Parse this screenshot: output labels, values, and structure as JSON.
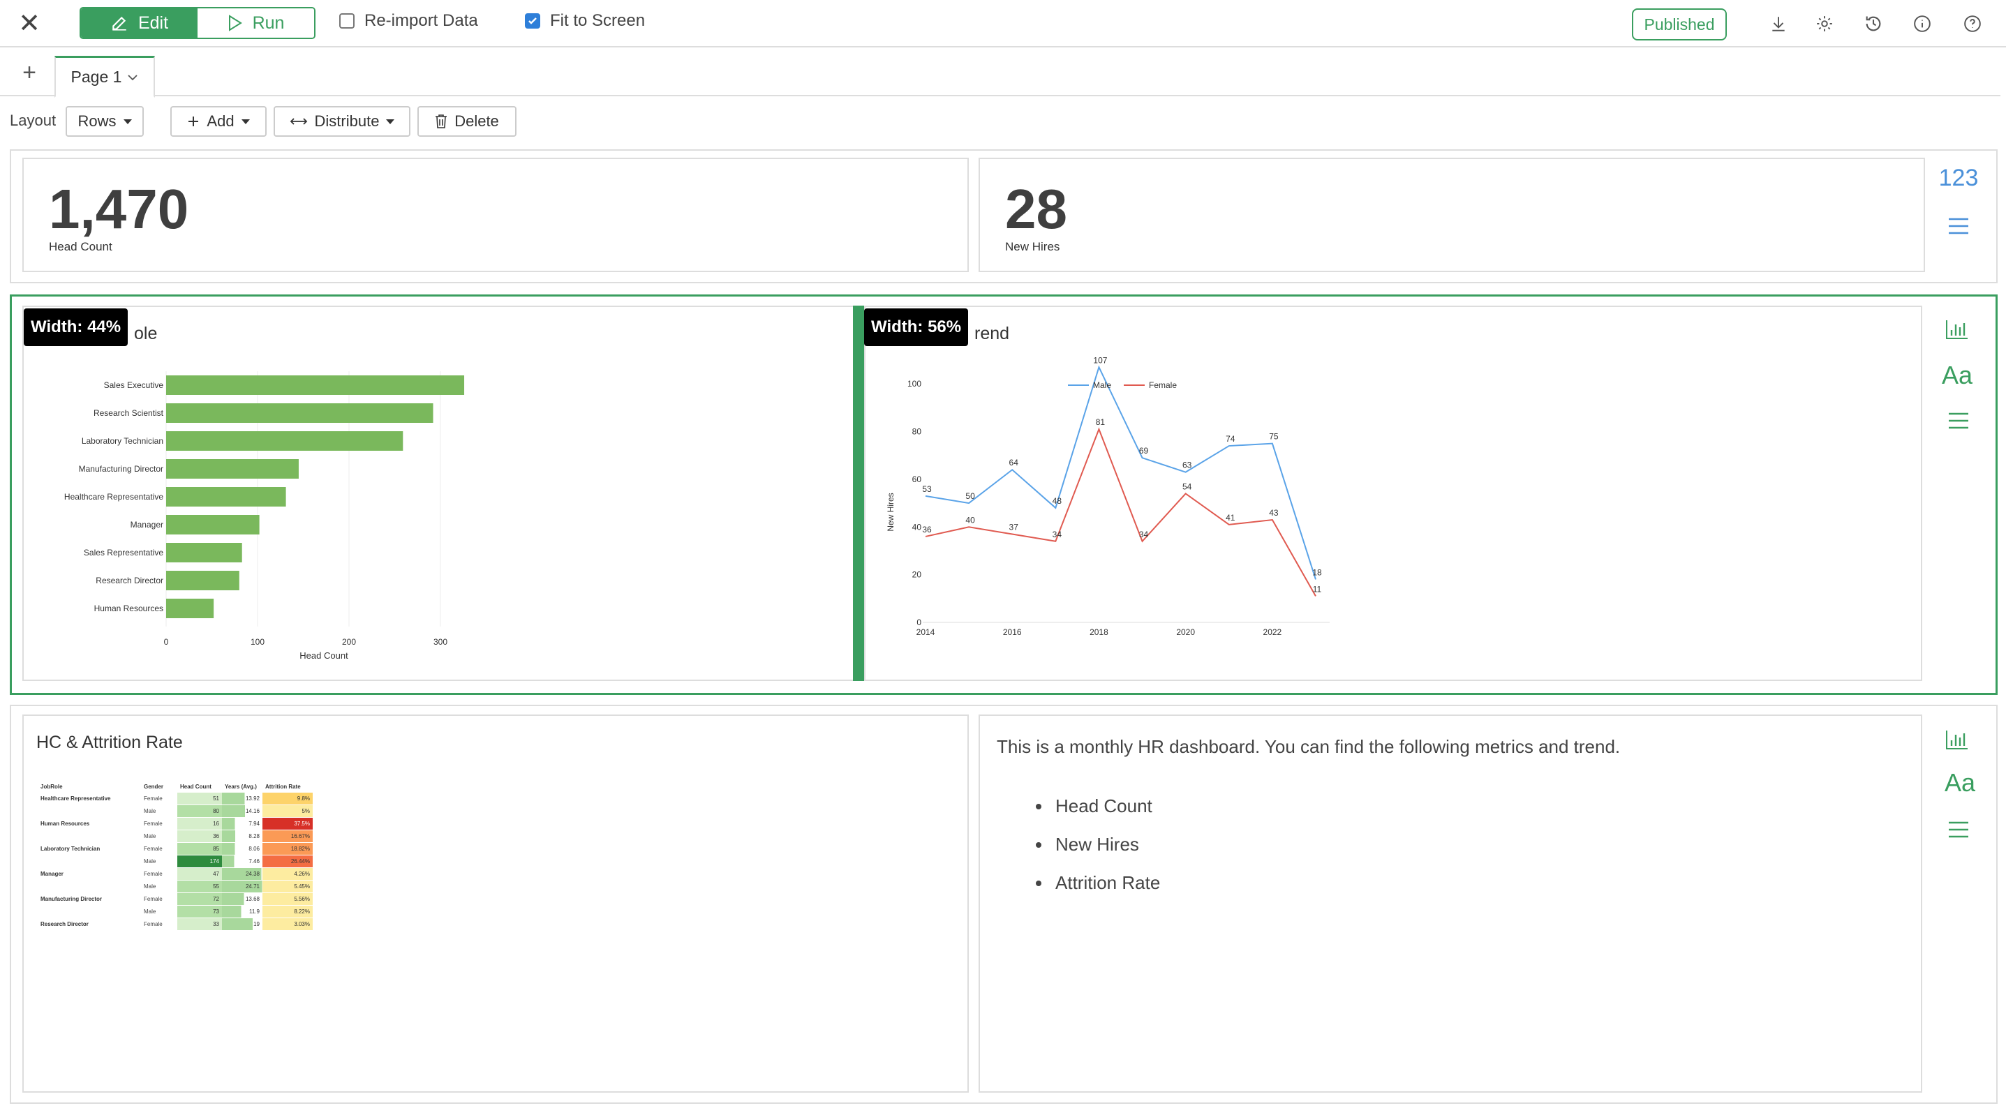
{
  "toolbar": {
    "close_glyph": "✕",
    "edit_label": "Edit",
    "run_label": "Run",
    "reimport_label": "Re-import Data",
    "reimport_checked": false,
    "fit_label": "Fit to Screen",
    "fit_checked": true,
    "published_label": "Published",
    "icons": [
      "download-icon",
      "gear-icon",
      "history-icon",
      "info-icon",
      "help-icon"
    ]
  },
  "pages": {
    "add_glyph": "+",
    "tabs": [
      {
        "label": "Page 1"
      }
    ]
  },
  "layout_bar": {
    "label": "Layout",
    "layout_value": "Rows",
    "add_label": "Add",
    "distribute_label": "Distribute",
    "delete_label": "Delete"
  },
  "kpis": [
    {
      "value": "1,470",
      "label": "Head Count"
    },
    {
      "value": "28",
      "label": "New Hires"
    }
  ],
  "row1_side": {
    "number_label": "123"
  },
  "colors": {
    "accent": "#3a9e5f",
    "bar": "#7ab85c",
    "male": "#5aa3e8",
    "female": "#e05a50"
  },
  "row2": {
    "left": {
      "width_tag": "Width: 44%",
      "title_visible": "ole"
    },
    "right": {
      "width_tag": "Width: 56%",
      "title_visible": "rend"
    }
  },
  "side_icons": {
    "font_label": "Aa"
  },
  "row3": {
    "table_title": "HC & Attrition Rate",
    "description": "This is a monthly HR dashboard. You can find the following metrics and trend.",
    "bullets": [
      "Head Count",
      "New Hires",
      "Attrition Rate"
    ]
  },
  "chart_data": [
    {
      "type": "bar",
      "orientation": "horizontal",
      "categories": [
        "Sales Executive",
        "Research Scientist",
        "Laboratory Technician",
        "Manufacturing Director",
        "Healthcare Representative",
        "Manager",
        "Sales Representative",
        "Research Director",
        "Human Resources"
      ],
      "values": [
        326,
        292,
        259,
        145,
        131,
        102,
        83,
        80,
        52
      ],
      "xlabel": "Head Count",
      "ylabel": "",
      "xlim": [
        0,
        330
      ],
      "xticks": [
        0,
        100,
        200,
        300
      ],
      "grid": true,
      "color": "#7ab85c"
    },
    {
      "type": "line",
      "x": [
        2014,
        2015,
        2016,
        2017,
        2018,
        2019,
        2020,
        2021,
        2022,
        2023
      ],
      "xticks": [
        "2014",
        "2016",
        "2018",
        "2020",
        "2022"
      ],
      "series": [
        {
          "name": "Male",
          "values": [
            53,
            50,
            64,
            48,
            107,
            69,
            63,
            74,
            75,
            18
          ],
          "color": "#5aa3e8"
        },
        {
          "name": "Female",
          "values": [
            36,
            40,
            37,
            34,
            81,
            34,
            54,
            41,
            43,
            11
          ],
          "color": "#e05a50"
        }
      ],
      "ylabel": "New Hires",
      "xlabel": "",
      "ylim": [
        0,
        110
      ],
      "yticks": [
        0,
        20,
        40,
        60,
        80,
        100
      ],
      "legend": "top-center",
      "grid": false
    },
    {
      "type": "table",
      "columns": [
        "JobRole",
        "Gender",
        "Head Count",
        "Years (Avg.)",
        "Attrition Rate"
      ],
      "rows": [
        [
          "Healthcare Representative",
          "Female",
          51,
          "13.92",
          "9.8%"
        ],
        [
          "",
          "Male",
          80,
          "14.16",
          "5%"
        ],
        [
          "Human Resources",
          "Female",
          16,
          "7.94",
          "37.5%"
        ],
        [
          "",
          "Male",
          36,
          "8.28",
          "16.67%"
        ],
        [
          "Laboratory Technician",
          "Female",
          85,
          "8.06",
          "18.82%"
        ],
        [
          "",
          "Male",
          174,
          "7.46",
          "26.44%"
        ],
        [
          "Manager",
          "Female",
          47,
          "24.38",
          "4.26%"
        ],
        [
          "",
          "Male",
          55,
          "24.71",
          "5.45%"
        ],
        [
          "Manufacturing Director",
          "Female",
          72,
          "13.68",
          "5.56%"
        ],
        [
          "",
          "Male",
          73,
          "11.9",
          "8.22%"
        ],
        [
          "Research Director",
          "Female",
          33,
          "19",
          "3.03%"
        ]
      ]
    }
  ]
}
